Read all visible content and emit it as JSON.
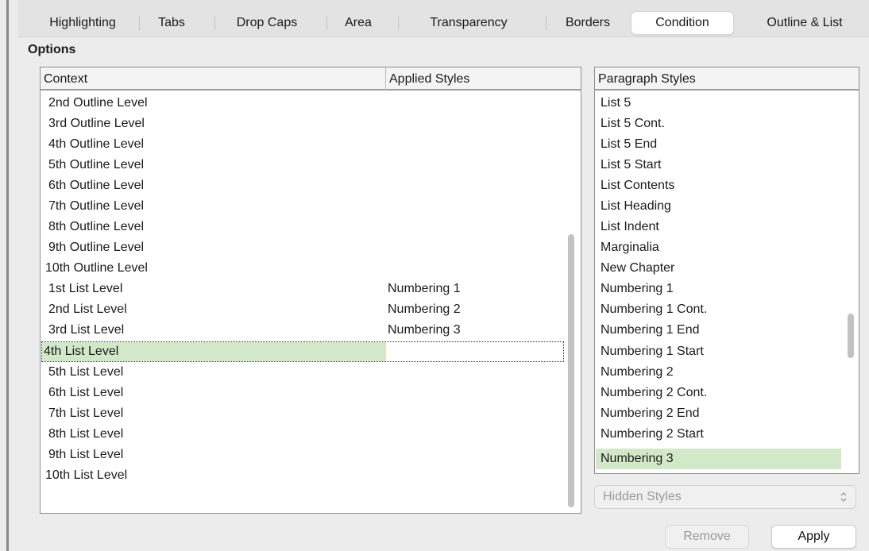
{
  "tabs": [
    {
      "label": "Highlighting"
    },
    {
      "label": "Tabs"
    },
    {
      "label": "Drop Caps"
    },
    {
      "label": "Area"
    },
    {
      "label": "Transparency"
    },
    {
      "label": "Borders"
    },
    {
      "label": "Condition",
      "active": true
    },
    {
      "label": "Outline & List"
    }
  ],
  "options_label": "Options",
  "conditions_table": {
    "headers": [
      "Context",
      "Applied Styles"
    ],
    "rows": [
      {
        "context": "2nd Outline Level",
        "style": ""
      },
      {
        "context": "3rd Outline Level",
        "style": ""
      },
      {
        "context": "4th Outline Level",
        "style": ""
      },
      {
        "context": "5th Outline Level",
        "style": ""
      },
      {
        "context": "6th Outline Level",
        "style": ""
      },
      {
        "context": "7th Outline Level",
        "style": ""
      },
      {
        "context": "8th Outline Level",
        "style": ""
      },
      {
        "context": "9th Outline Level",
        "style": ""
      },
      {
        "context": "10th Outline Level",
        "style": ""
      },
      {
        "context": "1st List Level",
        "style": "Numbering 1"
      },
      {
        "context": "2nd List Level",
        "style": "Numbering 2"
      },
      {
        "context": "3rd List Level",
        "style": "Numbering 3"
      },
      {
        "context": "4th List Level",
        "style": "",
        "selected": true
      },
      {
        "context": "5th List Level",
        "style": ""
      },
      {
        "context": "6th List Level",
        "style": ""
      },
      {
        "context": "7th List Level",
        "style": ""
      },
      {
        "context": "8th List Level",
        "style": ""
      },
      {
        "context": "9th List Level",
        "style": ""
      },
      {
        "context": "10th List Level",
        "style": ""
      }
    ]
  },
  "paragraph_styles": {
    "header": "Paragraph Styles",
    "items": [
      {
        "label": "List 5"
      },
      {
        "label": "List 5 Cont."
      },
      {
        "label": "List 5 End"
      },
      {
        "label": "List 5 Start"
      },
      {
        "label": "List Contents"
      },
      {
        "label": "List Heading"
      },
      {
        "label": "List Indent"
      },
      {
        "label": "Marginalia"
      },
      {
        "label": "New Chapter"
      },
      {
        "label": "Numbering 1"
      },
      {
        "label": "Numbering 1 Cont."
      },
      {
        "label": "Numbering 1 End"
      },
      {
        "label": "Numbering 1 Start"
      },
      {
        "label": "Numbering 2"
      },
      {
        "label": "Numbering 2 Cont."
      },
      {
        "label": "Numbering 2 End"
      },
      {
        "label": "Numbering 2 Start"
      },
      {
        "label": "Numbering 3",
        "selected": true
      }
    ]
  },
  "filter_dropdown": {
    "value": "Hidden Styles",
    "icon": "updown-chevron-icon"
  },
  "buttons": {
    "remove": "Remove",
    "apply": "Apply"
  },
  "colors": {
    "selection": "#d2e9c9",
    "tab_active": "#ffffff",
    "background": "#ececec"
  }
}
